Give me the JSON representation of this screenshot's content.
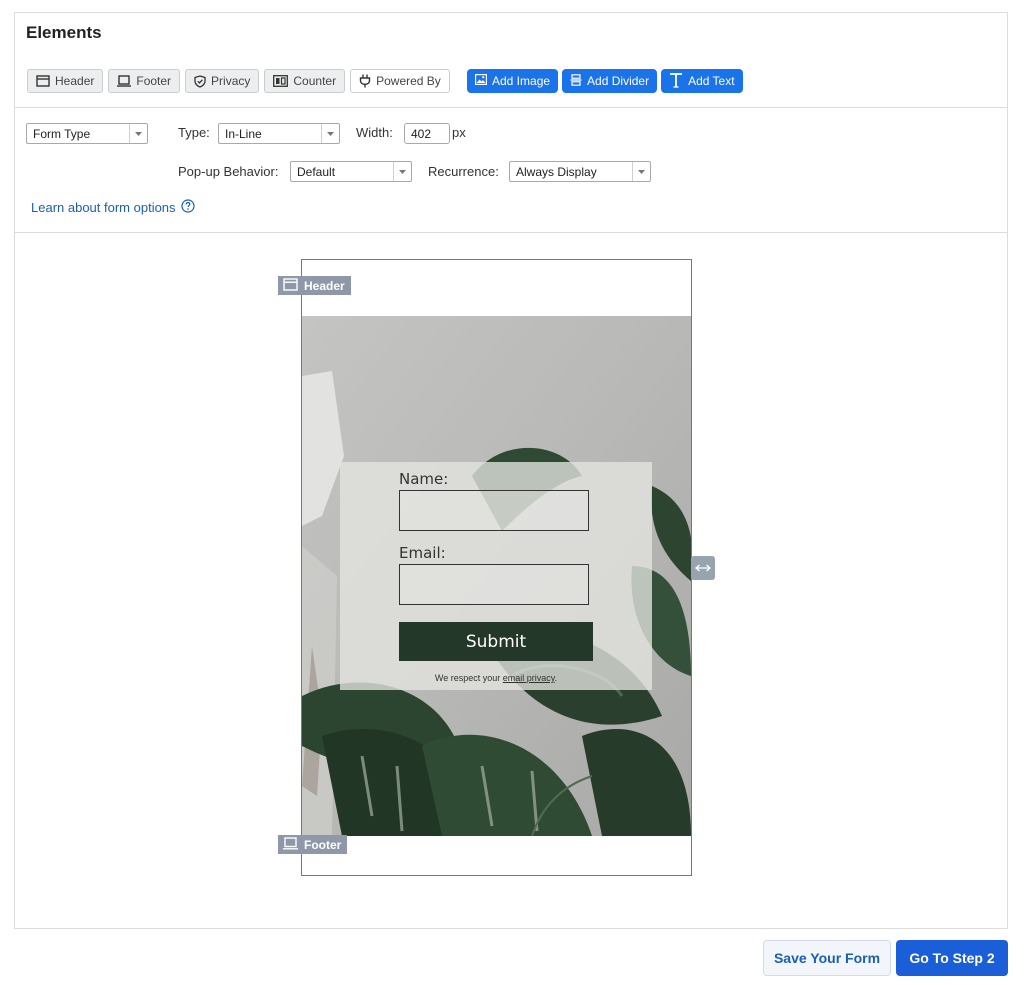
{
  "panel": {
    "title": "Elements"
  },
  "element_buttons": [
    {
      "label": "Header",
      "icon": "header-icon"
    },
    {
      "label": "Footer",
      "icon": "footer-icon"
    },
    {
      "label": "Privacy",
      "icon": "shield-icon"
    },
    {
      "label": "Counter",
      "icon": "counter-icon"
    },
    {
      "label": "Powered By",
      "icon": "plug-icon"
    }
  ],
  "add_buttons": [
    {
      "label": "Add Image",
      "icon": "image-icon"
    },
    {
      "label": "Add Divider",
      "icon": "divider-icon"
    },
    {
      "label": "Add Text",
      "icon": "text-icon"
    }
  ],
  "options": {
    "form_type": "Form Type",
    "type_label": "Type:",
    "type_value": "In-Line",
    "width_label": "Width:",
    "width_value": "402",
    "width_unit": "px",
    "popup_label": "Pop-up Behavior:",
    "popup_value": "Default",
    "recurrence_label": "Recurrence:",
    "recurrence_value": "Always Display",
    "learn_link": "Learn about form options"
  },
  "canvas": {
    "header_tag": "Header",
    "footer_tag": "Footer",
    "name_label": "Name:",
    "email_label": "Email:",
    "submit_label": "Submit",
    "privacy_prefix": "We respect your ",
    "privacy_link": "email privacy",
    "privacy_suffix": "."
  },
  "footer_actions": {
    "save_label": "Save Your Form",
    "next_label": "Go To Step 2"
  },
  "colors": {
    "accent": "#1a73e8",
    "submit_bg": "#24382a",
    "tag_bg": "#8e98a8"
  }
}
